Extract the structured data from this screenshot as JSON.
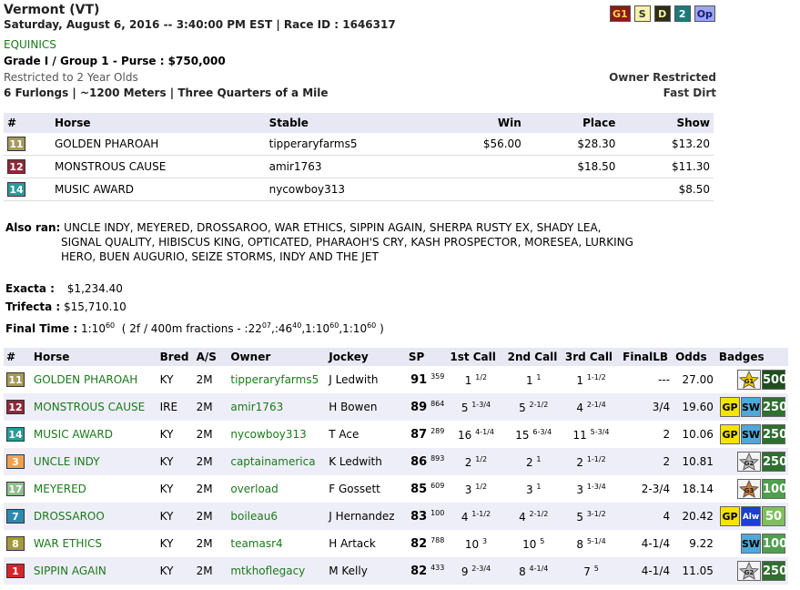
{
  "header": {
    "title": "Vermont (VT)",
    "subtitle": "Saturday, August 6, 2016 -- 3:40:00 PM EST | Race ID : 1646317",
    "category": "EQUINICS",
    "grade": "Grade I / Group 1 - Purse : $750,000",
    "restriction": "Restricted to 2 Year Olds",
    "distance": "6 Furlongs | ~1200 Meters | Three Quarters of a Mile",
    "owner_restricted": "Owner Restricted",
    "surface": "Fast Dirt"
  },
  "tags": [
    {
      "label": "G1",
      "bg": "#8b1a1a",
      "fg": "#ffd24a"
    },
    {
      "label": "S",
      "bg": "#f7f2a8",
      "fg": "#333333"
    },
    {
      "label": "D",
      "bg": "#2e2e16",
      "fg": "#f7f2a8"
    },
    {
      "label": "2",
      "bg": "#1e7a7a",
      "fg": "#ffffff"
    },
    {
      "label": "Op",
      "bg": "#9aa7ee",
      "fg": "#1a1a6a"
    }
  ],
  "results": {
    "headers": {
      "num": "#",
      "horse": "Horse",
      "stable": "Stable",
      "win": "Win",
      "place": "Place",
      "show": "Show"
    },
    "rows": [
      {
        "pp": "11",
        "pp_color": "#a59a5c",
        "horse": "GOLDEN PHAROAH",
        "stable": "tipperaryfarms5",
        "win": "$56.00",
        "place": "$28.30",
        "show": "$13.20"
      },
      {
        "pp": "12",
        "pp_color": "#8b2a3a",
        "horse": "MONSTROUS CAUSE",
        "stable": "amir1763",
        "win": "",
        "place": "$18.50",
        "show": "$11.30"
      },
      {
        "pp": "14",
        "pp_color": "#2a9a9a",
        "horse": "MUSIC AWARD",
        "stable": "nycowboy313",
        "win": "",
        "place": "",
        "show": "$8.50"
      }
    ]
  },
  "also_ran": {
    "label": "Also ran:",
    "line1": "UNCLE INDY, MEYERED, DROSSAROO, WAR ETHICS, SIPPIN AGAIN, SHERPA RUSTY EX, SHADY LEA,",
    "line2": "SIGNAL QUALITY, HIBISCUS KING, OPTICATED, PHARAOH'S CRY, KASH PROSPECTOR, MORESEA, LURKING",
    "line3": "HERO, BUEN AUGURIO, SEIZE STORMS, INDY AND THE JET"
  },
  "payouts": {
    "exacta_label": "Exacta :",
    "exacta": "$1,234.40",
    "trifecta_label": "Trifecta :",
    "trifecta": "$15,710.10",
    "final_time_label": "Final Time :",
    "final_time": "1:10",
    "final_time_sup": "60",
    "fractions_a": "( 2f / 400m fractions - :22",
    "frac1_sup": "07",
    "fractions_b": ",:46",
    "frac2_sup": "40",
    "fractions_c": ",1:10",
    "frac3_sup": "60",
    "fractions_d": ",1:10",
    "frac4_sup": "60",
    "fractions_e": ")"
  },
  "main": {
    "headers": {
      "num": "#",
      "horse": "Horse",
      "bred": "Bred",
      "as": "A/S",
      "owner": "Owner",
      "jockey": "Jockey",
      "sp": "SP",
      "c1": "1st Call",
      "c2": "2nd Call",
      "c3": "3rd Call",
      "flb": "FinalLB",
      "odds": "Odds",
      "badges": "Badges"
    },
    "rows": [
      {
        "pp": "11",
        "pp_color": "#a59a5c",
        "horse": "GOLDEN PHAROAH",
        "bred": "KY",
        "as": "2M",
        "owner": "tipperaryfarms5",
        "jockey": "J Ledwith",
        "sp": "91",
        "sp_sup": "359",
        "c1": "1",
        "c1s": "1/2",
        "c2": "1",
        "c2s": "1",
        "c3": "1",
        "c3s": "1-1/2",
        "flb": "---",
        "odds": "27.00",
        "badges": [
          {
            "type": "star",
            "label": "G1",
            "color": "#f2c200"
          },
          {
            "type": "pt",
            "label": "500",
            "color": "#1f4f1f"
          }
        ]
      },
      {
        "pp": "12",
        "pp_color": "#8b2a3a",
        "horse": "MONSTROUS CAUSE",
        "bred": "IRE",
        "as": "2M",
        "owner": "amir1763",
        "jockey": "H Bowen",
        "sp": "89",
        "sp_sup": "864",
        "c1": "5",
        "c1s": "1-3/4",
        "c2": "5",
        "c2s": "2-1/2",
        "c3": "4",
        "c3s": "2-1/4",
        "flb": "3/4",
        "odds": "19.60",
        "badges": [
          {
            "type": "gp",
            "label": "GP"
          },
          {
            "type": "sw",
            "label": "SW"
          },
          {
            "type": "pt",
            "label": "250",
            "color": "#2f6f2f"
          }
        ]
      },
      {
        "pp": "14",
        "pp_color": "#2a9a9a",
        "horse": "MUSIC AWARD",
        "bred": "KY",
        "as": "2M",
        "owner": "nycowboy313",
        "jockey": "T Ace",
        "sp": "87",
        "sp_sup": "289",
        "c1": "16",
        "c1s": "4-1/4",
        "c2": "15",
        "c2s": "6-3/4",
        "c3": "11",
        "c3s": "5-3/4",
        "flb": "2",
        "odds": "10.06",
        "badges": [
          {
            "type": "gp",
            "label": "GP"
          },
          {
            "type": "sw",
            "label": "SW"
          },
          {
            "type": "pt",
            "label": "250",
            "color": "#2f6f2f"
          }
        ]
      },
      {
        "pp": "3",
        "pp_color": "#f0a050",
        "horse": "UNCLE INDY",
        "bred": "KY",
        "as": "2M",
        "owner": "captainamerica",
        "jockey": "K Ledwith",
        "sp": "86",
        "sp_sup": "893",
        "c1": "2",
        "c1s": "1/2",
        "c2": "2",
        "c2s": "1",
        "c3": "2",
        "c3s": "1-1/2",
        "flb": "2",
        "odds": "10.81",
        "badges": [
          {
            "type": "star",
            "label": "G2",
            "color": "#bbbbbb"
          },
          {
            "type": "pt",
            "label": "250",
            "color": "#2f6f2f"
          }
        ]
      },
      {
        "pp": "17",
        "pp_color": "#8fbf8f",
        "horse": "MEYERED",
        "bred": "KY",
        "as": "2M",
        "owner": "overload",
        "jockey": "F Gossett",
        "sp": "85",
        "sp_sup": "609",
        "c1": "3",
        "c1s": "1/2",
        "c2": "3",
        "c2s": "1",
        "c3": "3",
        "c3s": "1-3/4",
        "flb": "2-3/4",
        "odds": "18.14",
        "badges": [
          {
            "type": "star",
            "label": "G3",
            "color": "#c87a3a"
          },
          {
            "type": "pt",
            "label": "100",
            "color": "#4f9f4f"
          }
        ]
      },
      {
        "pp": "7",
        "pp_color": "#2a8ab0",
        "horse": "DROSSAROO",
        "bred": "KY",
        "as": "2M",
        "owner": "boileau6",
        "jockey": "J Hernandez",
        "sp": "83",
        "sp_sup": "100",
        "c1": "4",
        "c1s": "1-1/2",
        "c2": "4",
        "c2s": "2-1/2",
        "c3": "5",
        "c3s": "3-1/2",
        "flb": "4",
        "odds": "20.42",
        "badges": [
          {
            "type": "gp",
            "label": "GP"
          },
          {
            "type": "alw",
            "label": "Alw"
          },
          {
            "type": "pt",
            "label": "50",
            "color": "#7fbf5f"
          }
        ]
      },
      {
        "pp": "8",
        "pp_color": "#a59a3a",
        "horse": "WAR ETHICS",
        "bred": "KY",
        "as": "2M",
        "owner": "teamasr4",
        "jockey": "H Artack",
        "sp": "82",
        "sp_sup": "788",
        "c1": "10",
        "c1s": "3",
        "c2": "10",
        "c2s": "5",
        "c3": "8",
        "c3s": "5-1/4",
        "flb": "4-1/4",
        "odds": "9.22",
        "badges": [
          {
            "type": "sw",
            "label": "SW"
          },
          {
            "type": "pt",
            "label": "100",
            "color": "#4f9f4f"
          }
        ]
      },
      {
        "pp": "1",
        "pp_color": "#d8222a",
        "horse": "SIPPIN AGAIN",
        "bred": "KY",
        "as": "2M",
        "owner": "mtkhoflegacy",
        "jockey": "M Kelly",
        "sp": "82",
        "sp_sup": "433",
        "c1": "9",
        "c1s": "2-3/4",
        "c2": "8",
        "c2s": "4-1/4",
        "c3": "7",
        "c3s": "5",
        "flb": "4-1/4",
        "odds": "11.05",
        "badges": [
          {
            "type": "star",
            "label": "G2",
            "color": "#bbbbbb"
          },
          {
            "type": "pt",
            "label": "250",
            "color": "#2f6f2f"
          }
        ]
      }
    ]
  }
}
